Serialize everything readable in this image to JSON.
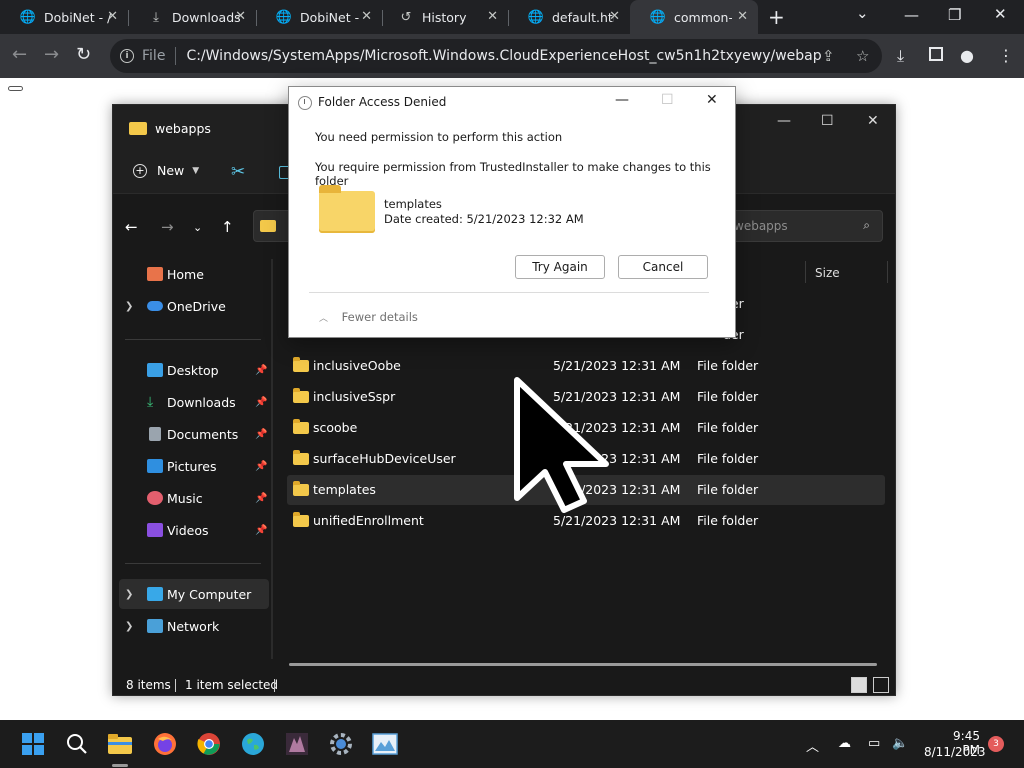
{
  "browser": {
    "tabs": [
      {
        "label": "DobiNet - /",
        "icon": "dobinet-favicon"
      },
      {
        "label": "Downloads",
        "icon": "download-icon"
      },
      {
        "label": "DobiNet - /",
        "icon": "dobinet-favicon"
      },
      {
        "label": "History",
        "icon": "history-icon"
      },
      {
        "label": "default.htm",
        "icon": "globe-icon"
      },
      {
        "label": "common-b",
        "icon": "globe-icon"
      }
    ],
    "omnibox": {
      "scheme": "File",
      "url": "C:/Windows/SystemApps/Microsoft.Windows.CloudExperienceHost_cw5n1h2txyewy/webapps/templ..."
    }
  },
  "explorer": {
    "title": "webapps",
    "new_label": "New",
    "search_placeholder": "webapps",
    "columns": {
      "size": "Size"
    },
    "sidebar": [
      {
        "label": "Home",
        "icon": "home-icon"
      },
      {
        "label": "OneDrive",
        "icon": "cloud-icon"
      },
      {
        "label": "Desktop",
        "icon": "desktop-icon"
      },
      {
        "label": "Downloads",
        "icon": "download-icon"
      },
      {
        "label": "Documents",
        "icon": "document-icon"
      },
      {
        "label": "Pictures",
        "icon": "picture-icon"
      },
      {
        "label": "Music",
        "icon": "music-icon"
      },
      {
        "label": "Videos",
        "icon": "video-icon"
      },
      {
        "label": "My Computer",
        "icon": "computer-icon"
      },
      {
        "label": "Network",
        "icon": "network-icon"
      }
    ],
    "files": [
      {
        "name": "",
        "date": "",
        "type": "older"
      },
      {
        "name": "",
        "date": "",
        "type": "older"
      },
      {
        "name": "inclusiveOobe",
        "date": "5/21/2023 12:31 AM",
        "type": "File folder"
      },
      {
        "name": "inclusiveSspr",
        "date": "5/21/2023 12:31 AM",
        "type": "File folder"
      },
      {
        "name": "scoobe",
        "date": "5/21/2023 12:31 AM",
        "type": "File folder"
      },
      {
        "name": "surfaceHubDeviceUser",
        "date": "5/21/2023 12:31 AM",
        "type": "File folder"
      },
      {
        "name": "templates",
        "date": "5/21/2023 12:31 AM",
        "type": "File folder"
      },
      {
        "name": "unifiedEnrollment",
        "date": "5/21/2023 12:31 AM",
        "type": "File folder"
      }
    ],
    "status": {
      "count": "8 items",
      "selected": "1 item selected"
    }
  },
  "dialog": {
    "title": "Folder Access Denied",
    "message1": "You need permission to perform this action",
    "message2": "You require permission from TrustedInstaller to make changes to this folder",
    "folder_name": "templates",
    "folder_date": "Date created: 5/21/2023 12:32 AM",
    "try_again": "Try Again",
    "cancel": "Cancel",
    "fewer_details": "Fewer details"
  },
  "taskbar": {
    "time": "9:45 PM",
    "date": "8/11/2023",
    "notifications": "3"
  },
  "colors": {
    "accent": "#0078d4",
    "folder": "#f3c84a",
    "explorer_bg": "#191919"
  }
}
